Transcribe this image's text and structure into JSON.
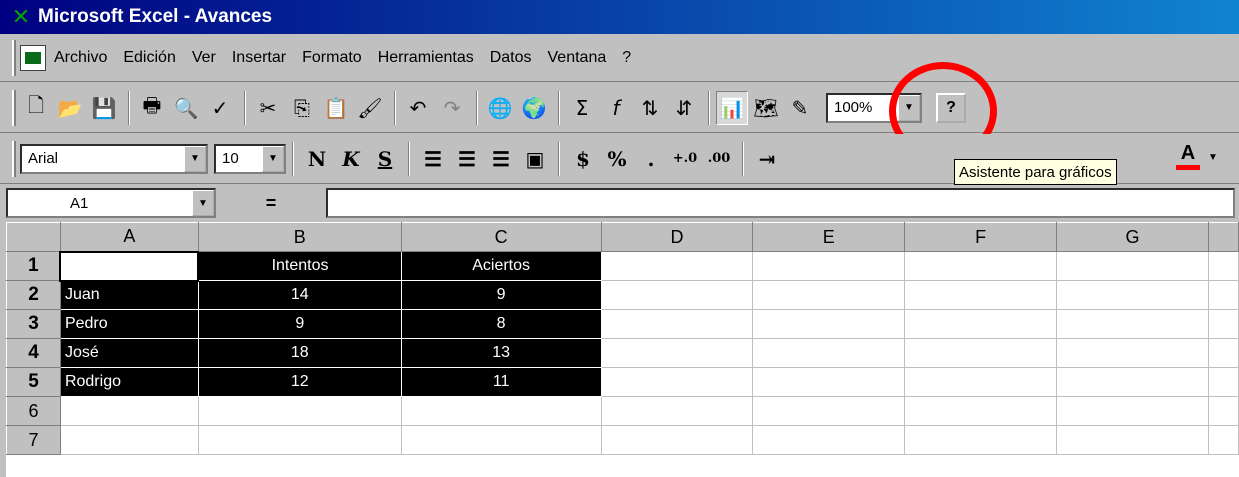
{
  "window": {
    "title": "Microsoft Excel - Avances"
  },
  "menu": {
    "items": [
      "Archivo",
      "Edición",
      "Ver",
      "Insertar",
      "Formato",
      "Herramientas",
      "Datos",
      "Ventana",
      "?"
    ]
  },
  "standard_toolbar": {
    "zoom": "100%"
  },
  "formatting_toolbar": {
    "font": "Arial",
    "size": "10",
    "tooltip": "Asistente para gráficos"
  },
  "formula_bar": {
    "cell_ref": "A1",
    "equals": "="
  },
  "sheet": {
    "columns": [
      "A",
      "B",
      "C",
      "D",
      "E",
      "F",
      "G"
    ],
    "rows": [
      {
        "num": "1",
        "a": "",
        "b": "Intentos",
        "c": "Aciertos"
      },
      {
        "num": "2",
        "a": "Juan",
        "b": "14",
        "c": "9"
      },
      {
        "num": "3",
        "a": "Pedro",
        "b": "9",
        "c": "8"
      },
      {
        "num": "4",
        "a": "José",
        "b": "18",
        "c": "13"
      },
      {
        "num": "5",
        "a": "Rodrigo",
        "b": "12",
        "c": "11"
      },
      {
        "num": "6",
        "a": "",
        "b": "",
        "c": ""
      },
      {
        "num": "7",
        "a": "",
        "b": "",
        "c": ""
      }
    ]
  },
  "colors": {
    "highlight": "#ff0000",
    "selection": "#000000",
    "titlebar": "#000080"
  }
}
